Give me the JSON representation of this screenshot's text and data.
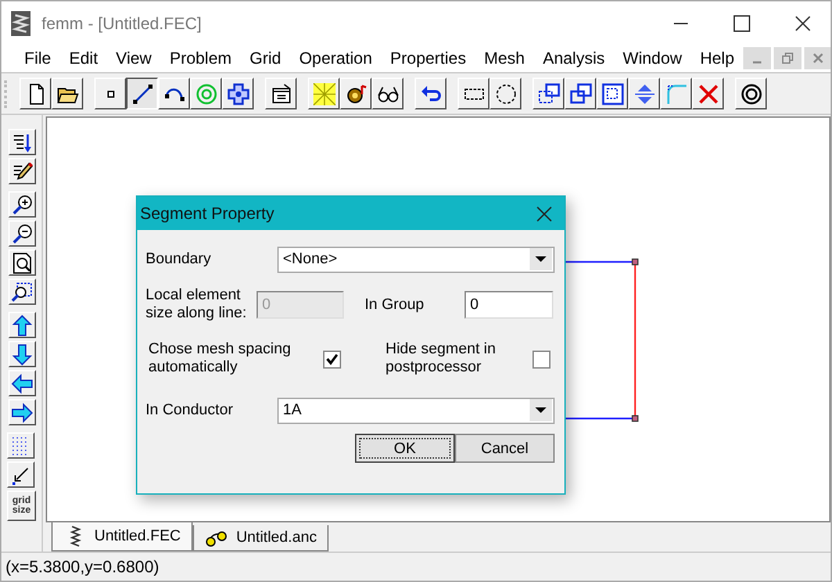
{
  "window": {
    "title": "femm - [Untitled.FEC]"
  },
  "menu": [
    "File",
    "Edit",
    "View",
    "Problem",
    "Grid",
    "Operation",
    "Properties",
    "Mesh",
    "Analysis",
    "Window",
    "Help"
  ],
  "toolbar": {
    "groups": [
      {
        "tools": [
          {
            "kind": "new",
            "selected": false
          },
          {
            "kind": "open",
            "selected": false
          }
        ]
      },
      {
        "tools": [
          {
            "kind": "node",
            "selected": false
          },
          {
            "kind": "segment",
            "selected": true
          },
          {
            "kind": "arc",
            "selected": false
          },
          {
            "kind": "label",
            "selected": false
          },
          {
            "kind": "group",
            "selected": false
          }
        ]
      },
      {
        "tools": [
          {
            "kind": "props",
            "selected": false
          }
        ]
      },
      {
        "tools": [
          {
            "kind": "mesh",
            "selected": false
          },
          {
            "kind": "run",
            "selected": false
          },
          {
            "kind": "view",
            "selected": false
          }
        ]
      },
      {
        "tools": [
          {
            "kind": "undo",
            "selected": false
          }
        ]
      },
      {
        "tools": [
          {
            "kind": "rectsel",
            "selected": false
          },
          {
            "kind": "circlesel",
            "selected": false
          }
        ]
      },
      {
        "tools": [
          {
            "kind": "copy",
            "selected": false
          },
          {
            "kind": "move",
            "selected": false
          },
          {
            "kind": "scale",
            "selected": false
          },
          {
            "kind": "mirror",
            "selected": false
          },
          {
            "kind": "fillet",
            "selected": false
          },
          {
            "kind": "delete",
            "selected": false
          }
        ]
      },
      {
        "tools": [
          {
            "kind": "ring",
            "selected": false
          }
        ]
      }
    ]
  },
  "side_toolbar": {
    "groups": [
      {
        "tools": [
          {
            "kind": "sort"
          },
          {
            "kind": "edit"
          }
        ]
      },
      {
        "tools": [
          {
            "kind": "zoomin"
          },
          {
            "kind": "zoomout"
          },
          {
            "kind": "zoomfit"
          },
          {
            "kind": "zoomwin"
          }
        ]
      },
      {
        "tools": [
          {
            "kind": "up"
          },
          {
            "kind": "down"
          },
          {
            "kind": "left"
          },
          {
            "kind": "right"
          }
        ]
      },
      {
        "tools": [
          {
            "kind": "grid"
          },
          {
            "kind": "snap"
          },
          {
            "kind": "text",
            "label": "grid size"
          }
        ]
      }
    ]
  },
  "dialog": {
    "title": "Segment Property",
    "boundary": {
      "label": "Boundary",
      "value": "<None>"
    },
    "element_size": {
      "label": "Local element size along line:",
      "value": "0",
      "disabled": true
    },
    "group": {
      "label": "In Group",
      "value": "0"
    },
    "auto_mesh": {
      "label": "Chose mesh spacing automatically",
      "checked": true
    },
    "hide": {
      "label": "Hide segment in postprocessor",
      "checked": false
    },
    "conductor": {
      "label": "In Conductor",
      "value": "1A"
    },
    "buttons": [
      {
        "label": "OK",
        "default": true
      },
      {
        "label": "Cancel",
        "default": false
      }
    ]
  },
  "tabs": [
    {
      "label": "Untitled.FEC",
      "kind": "fec",
      "selected": true
    },
    {
      "label": "Untitled.anc",
      "kind": "anc",
      "selected": false
    }
  ],
  "status_bar": "(x=5.3800,y=0.6800)"
}
